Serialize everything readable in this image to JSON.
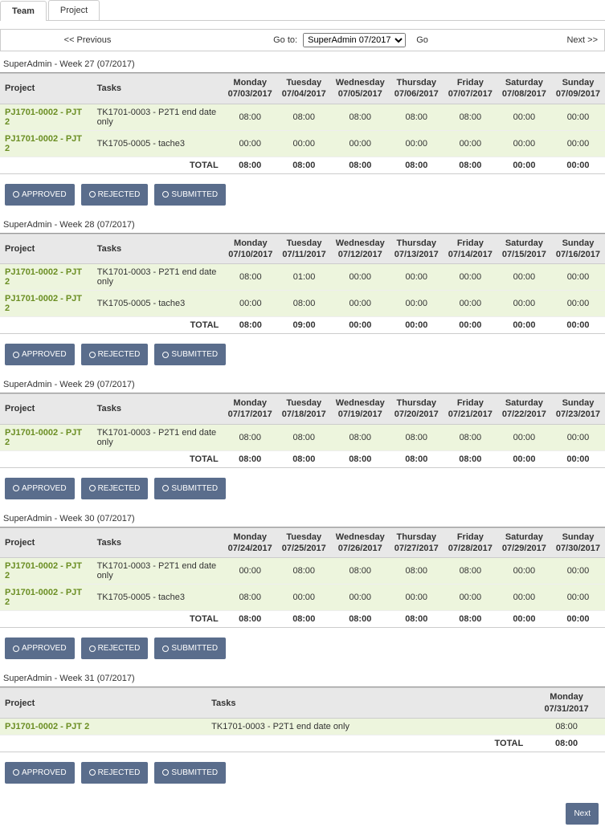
{
  "tabs": {
    "team": "Team",
    "project": "Project"
  },
  "nav": {
    "prev": "<< Previous",
    "goto_label": "Go to:",
    "selected_period": "SuperAdmin 07/2017",
    "go": "Go",
    "next": "Next >>"
  },
  "day_names": [
    "Monday",
    "Tuesday",
    "Wednesday",
    "Thursday",
    "Friday",
    "Saturday",
    "Sunday"
  ],
  "columns": {
    "project": "Project",
    "tasks": "Tasks",
    "total": "TOTAL"
  },
  "buttons": {
    "approved": "APPROVED",
    "rejected": "REJECTED",
    "submitted": "SUBMITTED",
    "next": "Next"
  },
  "weeks": [
    {
      "label": "SuperAdmin - Week 27 (07/2017)",
      "dates": [
        "07/03/2017",
        "07/04/2017",
        "07/05/2017",
        "07/06/2017",
        "07/07/2017",
        "07/08/2017",
        "07/09/2017"
      ],
      "rows": [
        {
          "project": "PJ1701-0002 - PJT 2",
          "task": "TK1701-0003 - P2T1 end date only",
          "values": [
            "08:00",
            "08:00",
            "08:00",
            "08:00",
            "08:00",
            "00:00",
            "00:00"
          ]
        },
        {
          "project": "PJ1701-0002 - PJT 2",
          "task": "TK1705-0005 - tache3",
          "values": [
            "00:00",
            "00:00",
            "00:00",
            "00:00",
            "00:00",
            "00:00",
            "00:00"
          ]
        }
      ],
      "totals": [
        "08:00",
        "08:00",
        "08:00",
        "08:00",
        "08:00",
        "00:00",
        "00:00"
      ]
    },
    {
      "label": "SuperAdmin - Week 28 (07/2017)",
      "dates": [
        "07/10/2017",
        "07/11/2017",
        "07/12/2017",
        "07/13/2017",
        "07/14/2017",
        "07/15/2017",
        "07/16/2017"
      ],
      "rows": [
        {
          "project": "PJ1701-0002 - PJT 2",
          "task": "TK1701-0003 - P2T1 end date only",
          "values": [
            "08:00",
            "01:00",
            "00:00",
            "00:00",
            "00:00",
            "00:00",
            "00:00"
          ]
        },
        {
          "project": "PJ1701-0002 - PJT 2",
          "task": "TK1705-0005 - tache3",
          "values": [
            "00:00",
            "08:00",
            "00:00",
            "00:00",
            "00:00",
            "00:00",
            "00:00"
          ]
        }
      ],
      "totals": [
        "08:00",
        "09:00",
        "00:00",
        "00:00",
        "00:00",
        "00:00",
        "00:00"
      ]
    },
    {
      "label": "SuperAdmin - Week 29 (07/2017)",
      "dates": [
        "07/17/2017",
        "07/18/2017",
        "07/19/2017",
        "07/20/2017",
        "07/21/2017",
        "07/22/2017",
        "07/23/2017"
      ],
      "rows": [
        {
          "project": "PJ1701-0002 - PJT 2",
          "task": "TK1701-0003 - P2T1 end date only",
          "values": [
            "08:00",
            "08:00",
            "08:00",
            "08:00",
            "08:00",
            "00:00",
            "00:00"
          ]
        }
      ],
      "totals": [
        "08:00",
        "08:00",
        "08:00",
        "08:00",
        "08:00",
        "00:00",
        "00:00"
      ]
    },
    {
      "label": "SuperAdmin - Week 30 (07/2017)",
      "dates": [
        "07/24/2017",
        "07/25/2017",
        "07/26/2017",
        "07/27/2017",
        "07/28/2017",
        "07/29/2017",
        "07/30/2017"
      ],
      "rows": [
        {
          "project": "PJ1701-0002 - PJT 2",
          "task": "TK1701-0003 - P2T1 end date only",
          "values": [
            "00:00",
            "08:00",
            "08:00",
            "08:00",
            "08:00",
            "00:00",
            "00:00"
          ]
        },
        {
          "project": "PJ1701-0002 - PJT 2",
          "task": "TK1705-0005 - tache3",
          "values": [
            "08:00",
            "00:00",
            "00:00",
            "00:00",
            "00:00",
            "00:00",
            "00:00"
          ]
        }
      ],
      "totals": [
        "08:00",
        "08:00",
        "08:00",
        "08:00",
        "08:00",
        "00:00",
        "00:00"
      ]
    },
    {
      "label": "SuperAdmin - Week 31 (07/2017)",
      "dates": [
        "07/31/2017"
      ],
      "rows": [
        {
          "project": "PJ1701-0002 - PJT 2",
          "task": "TK1701-0003 - P2T1 end date only",
          "values": [
            "08:00"
          ]
        }
      ],
      "totals": [
        "08:00"
      ]
    }
  ]
}
